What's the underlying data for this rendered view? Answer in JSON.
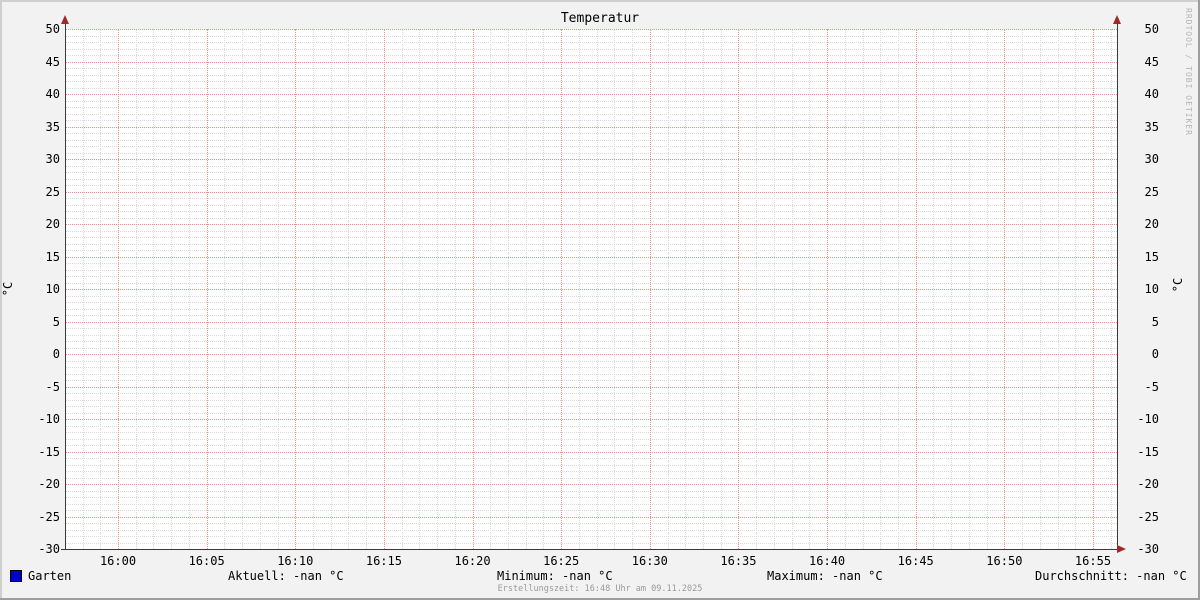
{
  "watermark": "RRDTOOL / TOBI OETIKER",
  "footer": {
    "text": "Erstellungszeit: 16:48 Uhr am 09.11.2025"
  },
  "legend": {
    "series": {
      "label": "Garten",
      "color": "#0000cc"
    },
    "stats": [
      {
        "id": "aktuell",
        "text": "Aktuell: -nan °C"
      },
      {
        "id": "minimum",
        "text": "Minimum: -nan °C"
      },
      {
        "id": "maximum",
        "text": "Maximum: -nan °C"
      },
      {
        "id": "durchschnitt",
        "text": "Durchschnitt: -nan °C"
      }
    ]
  },
  "colors": {
    "bg": "#f2f2f2",
    "canvas": "#ffffff",
    "grid_minor": "#d9d9d9",
    "grid_major": "#f08c8c",
    "axis": "#3a3a3a",
    "arrow": "#a02828",
    "text": "#000000",
    "muted": "#9a9a9a",
    "watermark": "#b5b5b5",
    "bevel_light": "#cfcfcf",
    "bevel_dark": "#9e9e9e",
    "swatch": "#0000cc"
  },
  "chart_data": {
    "type": "line",
    "title": "Temperatur",
    "ylabel": "°C",
    "ylabel_right": "°C",
    "ylim": [
      -30,
      50
    ],
    "y_tick_step": 5,
    "y_ticks": [
      "50",
      "45",
      "40",
      "35",
      "30",
      "25",
      "20",
      "15",
      "10",
      "5",
      "0",
      "-5",
      "-10",
      "-15",
      "-20",
      "-25",
      "-30"
    ],
    "x_ticks": [
      "16:00",
      "16:05",
      "16:10",
      "16:15",
      "16:20",
      "16:25",
      "16:30",
      "16:35",
      "16:40",
      "16:45",
      "16:50",
      "16:55"
    ],
    "minor_per_major_x": 5,
    "minor_per_major_y": 5,
    "grid": true,
    "legend_position": "bottom",
    "series": [
      {
        "name": "Garten",
        "color": "#0000cc",
        "values": []
      }
    ],
    "stats": {
      "aktuell": "-nan °C",
      "minimum": "-nan °C",
      "maximum": "-nan °C",
      "durchschnitt": "-nan °C"
    }
  }
}
